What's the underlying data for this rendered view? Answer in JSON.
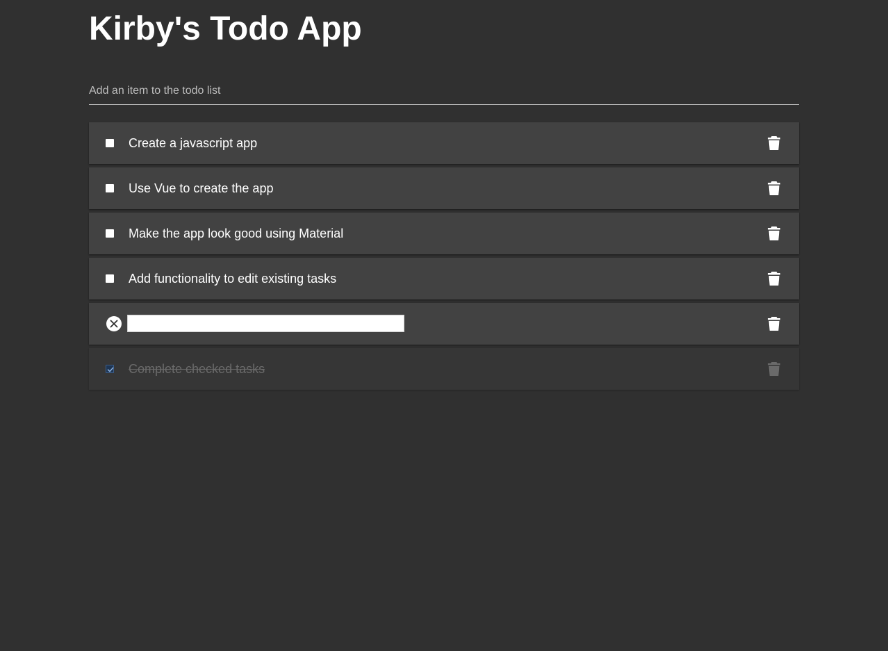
{
  "app": {
    "title": "Kirby's Todo App"
  },
  "add_item": {
    "placeholder": "Add an item to the todo list",
    "value": ""
  },
  "todos": [
    {
      "label": "Create a javascript app",
      "checked": false,
      "editing": false
    },
    {
      "label": "Use Vue to create the app",
      "checked": false,
      "editing": false
    },
    {
      "label": "Make the app look good using Material",
      "checked": false,
      "editing": false
    },
    {
      "label": "Add functionality to edit existing tasks",
      "checked": false,
      "editing": false
    },
    {
      "label": "",
      "checked": false,
      "editing": true,
      "edit_value": ""
    },
    {
      "label": "Complete checked tasks",
      "checked": true,
      "editing": false
    }
  ],
  "icons": {
    "delete": "trash-icon",
    "cancel_edit": "close-circle-icon",
    "checked": "check-icon"
  },
  "colors": {
    "background": "#303030",
    "card": "#424242",
    "card_done": "#363636",
    "text": "#ffffff",
    "text_done": "#6a6a6a",
    "checkbox_checked": "#1e3553"
  }
}
